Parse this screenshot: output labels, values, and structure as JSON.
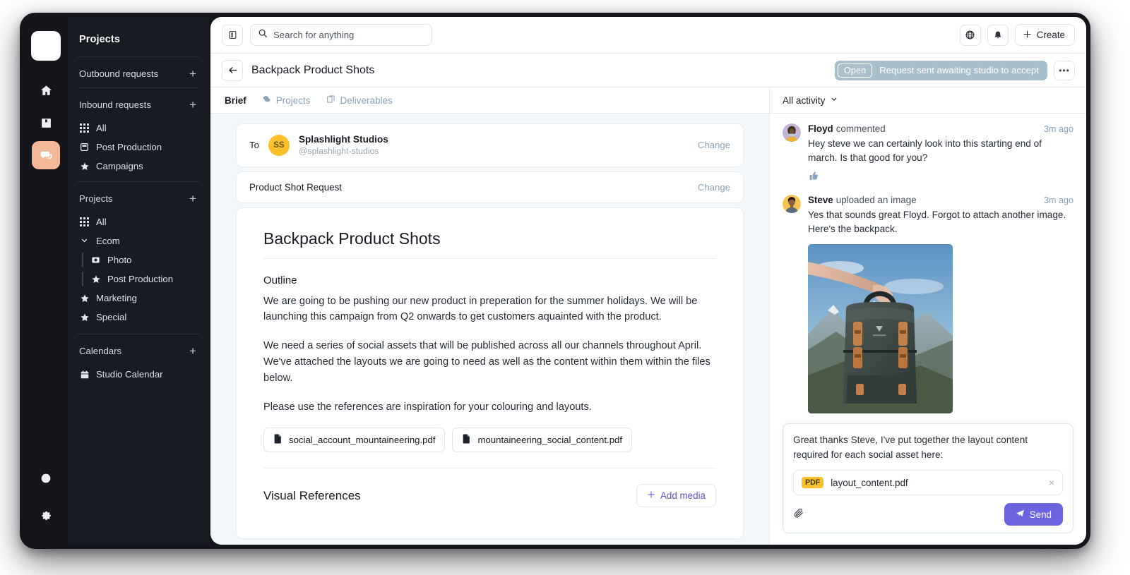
{
  "rail": {
    "logo": "app-logo",
    "items": [
      {
        "name": "home-icon",
        "active": false
      },
      {
        "name": "book-icon",
        "active": false
      },
      {
        "name": "chat-icon",
        "active": true
      }
    ],
    "bottom": [
      {
        "name": "theme-toggle-icon"
      },
      {
        "name": "settings-gear-icon"
      }
    ]
  },
  "sidebar": {
    "title": "Projects",
    "groups": [
      {
        "label": "Outbound requests",
        "add": "+",
        "items": []
      },
      {
        "label": "Inbound requests",
        "add": "+",
        "items": [
          {
            "label": "All",
            "icon": "grid-icon"
          },
          {
            "label": "Post Production",
            "icon": "square-icon"
          },
          {
            "label": "Campaigns",
            "icon": "star-icon"
          }
        ]
      },
      {
        "label": "Projects",
        "add": "+",
        "items": [
          {
            "label": "All",
            "icon": "grid-icon"
          },
          {
            "label": "Ecom",
            "icon": "chevron-down-icon"
          },
          {
            "label": "Photo",
            "icon": "photo-icon",
            "indent": true
          },
          {
            "label": "Post Production",
            "icon": "star-icon",
            "indent": true
          },
          {
            "label": "Marketing",
            "icon": "star-icon"
          },
          {
            "label": "Special",
            "icon": "star-icon"
          }
        ]
      },
      {
        "label": "Calendars",
        "add": "+",
        "items": [
          {
            "label": "Studio Calendar",
            "icon": "calendar-icon"
          }
        ]
      }
    ]
  },
  "topbar": {
    "panel_toggle": "panel-toggle-icon",
    "search_placeholder": "Search for anything",
    "search_value": "",
    "globe_icon": "globe-icon",
    "bell_icon": "bell-icon",
    "create_label": "Create"
  },
  "header": {
    "back": "back-arrow-icon",
    "title": "Backpack Product Shots",
    "status_chip": "Open",
    "status_text": "Request sent awaiting studio to accept",
    "overflow": "•••"
  },
  "tabs": [
    {
      "label": "Brief",
      "active": true,
      "icon": null
    },
    {
      "label": "Projects",
      "active": false,
      "icon": "projects-icon"
    },
    {
      "label": "Deliverables",
      "active": false,
      "icon": "deliverables-icon"
    }
  ],
  "brief": {
    "to_label": "To",
    "recipient_initials": "SS",
    "recipient_name": "Splashlight Studios",
    "recipient_handle": "@splashlight-studios",
    "change_label": "Change",
    "request_type": "Product Shot Request",
    "request_change_label": "Change",
    "doc_title": "Backpack Product Shots",
    "outline_heading": "Outline",
    "paragraphs": [
      "We are going to be pushing our new product in preperation for the summer holidays. We will be launching this campaign from Q2 onwards to get customers aquainted with the product.",
      "We need a series of social assets that will be published across all our channels throughout April. We've attached the layouts we are going to need as well as the content within them within the files below.",
      "Please use the references are inspiration for your colouring and layouts."
    ],
    "files": [
      {
        "name": "social_account_mountaineering.pdf"
      },
      {
        "name": "mountaineering_social_content.pdf"
      }
    ],
    "visual_references_heading": "Visual References",
    "add_media_label": "Add media"
  },
  "activity": {
    "filter_label": "All activity",
    "items": [
      {
        "author": "Floyd",
        "verb": "commented",
        "time": "3m ago",
        "text": "Hey steve we can certainly look into this starting end of march. Is that good for you?",
        "reaction": "thumbs-up",
        "has_image": false
      },
      {
        "author": "Steve",
        "verb": "uploaded an image",
        "time": "3m ago",
        "text": "Yes that sounds great Floyd. Forgot to attach another image. Here's the backpack.",
        "reaction": null,
        "has_image": true,
        "image_alt": "backpack-photo"
      }
    ]
  },
  "composer": {
    "text": "Great thanks Steve, I've put together the layout content required for each social asset here:",
    "attachment_badge": "PDF",
    "attachment_name": "layout_content.pdf",
    "remove_icon": "×",
    "attach_icon": "paperclip-icon",
    "send_label": "Send"
  },
  "colors": {
    "accent_purple": "#6c63e0",
    "status_blue_gray": "#a8bfcc",
    "avatar_yellow": "#fbc02a",
    "rail_active": "#f3b896",
    "sidebar_dark": "#181b22"
  }
}
